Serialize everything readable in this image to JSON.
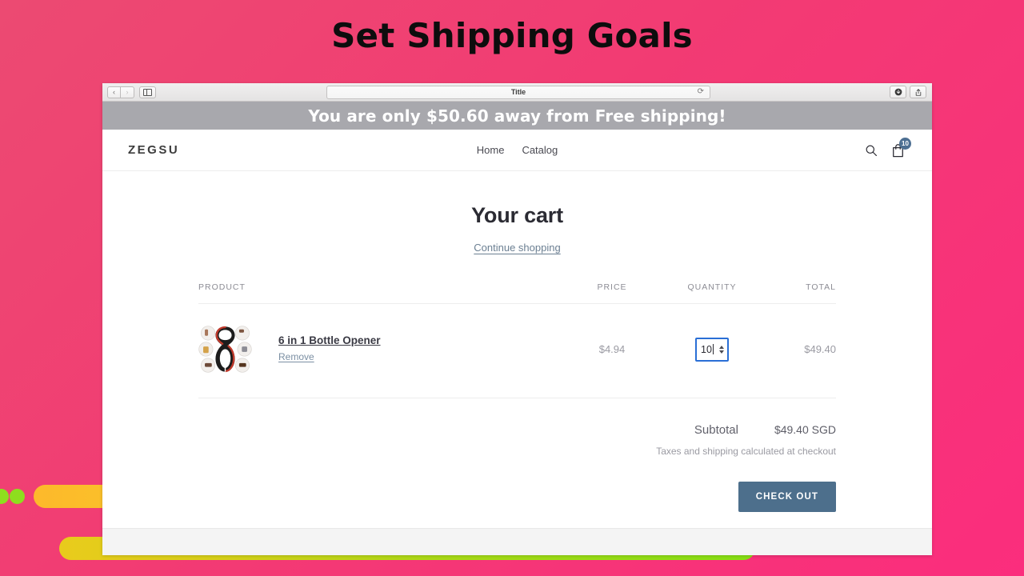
{
  "slide": {
    "title": "Set Shipping Goals",
    "background_from": "#ec4a72",
    "background_to": "#fb2d7d"
  },
  "browser": {
    "back_icon": "chevron-left-icon",
    "forward_icon": "chevron-right-icon",
    "sidebar_icon": "sidebar-toggle-icon",
    "url_value": "Title",
    "reload_icon": "reload-icon",
    "download_icon": "download-icon",
    "share_icon": "share-icon"
  },
  "banner": {
    "message": "You are only $50.60 away from Free shipping!",
    "background": "#a8a8ad"
  },
  "store_header": {
    "logo": "ZEGSU",
    "nav": [
      {
        "label": "Home"
      },
      {
        "label": "Catalog"
      }
    ],
    "search_icon": "search-icon",
    "cart_icon": "cart-icon",
    "cart_count": "10",
    "cart_badge_color": "#4d6f92"
  },
  "cart": {
    "title": "Your cart",
    "continue_shopping": "Continue shopping",
    "columns": {
      "product": "PRODUCT",
      "price": "PRICE",
      "quantity": "QUANTITY",
      "total": "TOTAL"
    },
    "items": [
      {
        "name": "6 in 1 Bottle Opener",
        "remove_label": "Remove",
        "price": "$4.94",
        "quantity": "10",
        "total": "$49.40",
        "thumbnail": "bottle-opener-product-image"
      }
    ],
    "subtotal_label": "Subtotal",
    "subtotal_value": "$49.40 SGD",
    "tax_note": "Taxes and shipping calculated at checkout",
    "checkout_label": "CHECK OUT",
    "checkout_color": "#4d6f8c"
  },
  "decoration": {
    "dot_color": "#8ede1e",
    "bar_orange_color": "#fdb92b",
    "bar_gradient_from": "#e9cb1c",
    "bar_gradient_to": "#86e014"
  }
}
